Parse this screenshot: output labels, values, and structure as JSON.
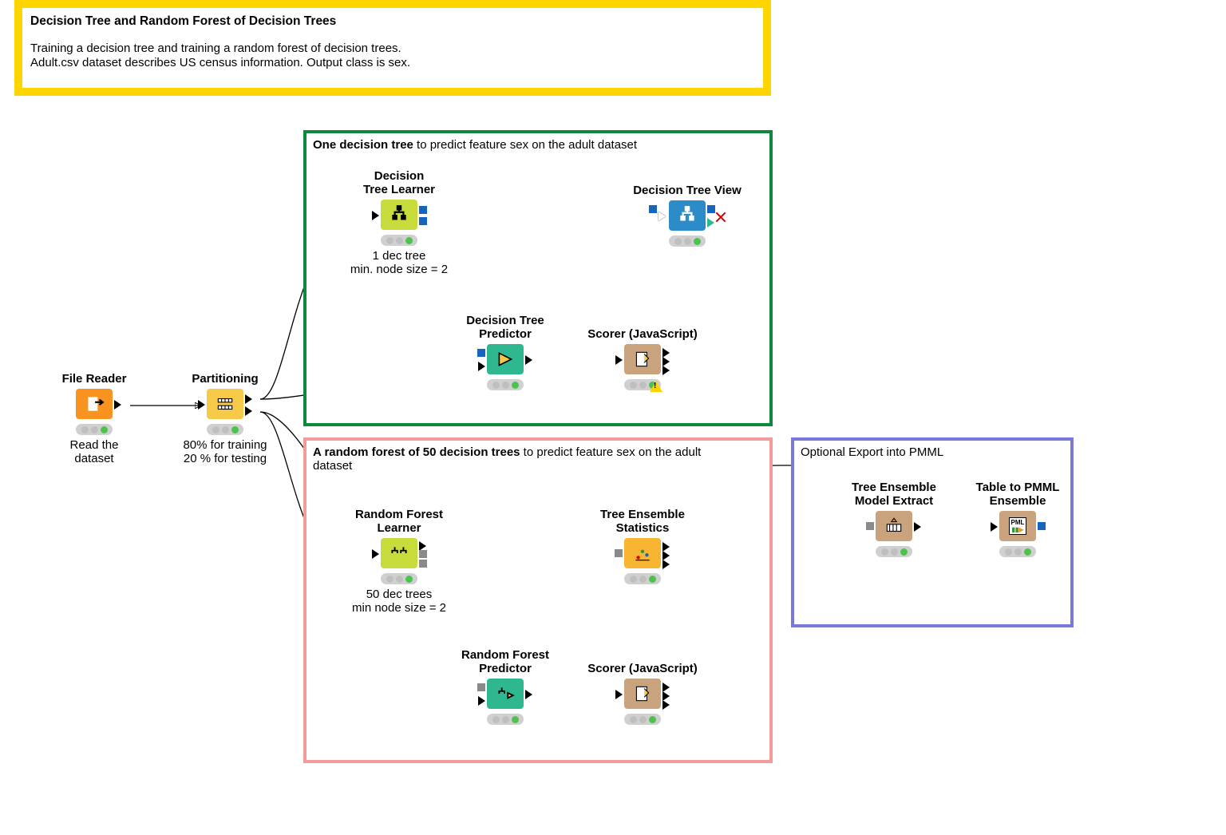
{
  "description": {
    "title": "Decision Tree and Random Forest of Decision Trees",
    "body": "Training a decision tree and training a random forest of decision trees.\nAdult.csv dataset describes US census information. Output class is sex."
  },
  "groups": {
    "green": {
      "title_prefix": "One decision tree",
      "title_rest": " to predict feature sex on the adult dataset"
    },
    "pink": {
      "title_prefix": "A random forest of 50 decision trees",
      "title_rest": " to predict feature sex on the adult dataset"
    },
    "purple": {
      "title": "Optional Export into PMML"
    }
  },
  "nodes": {
    "file_reader": {
      "label": "File Reader",
      "caption": "Read the\ndataset"
    },
    "partitioning": {
      "label": "Partitioning",
      "caption": "80% for training\n20 % for testing"
    },
    "dt_learner": {
      "label": "Decision\nTree Learner",
      "caption": "1 dec tree\nmin. node size = 2"
    },
    "dt_view": {
      "label": "Decision Tree View",
      "caption": ""
    },
    "dt_predictor": {
      "label": "Decision Tree\nPredictor",
      "caption": ""
    },
    "scorer1": {
      "label": "Scorer (JavaScript)",
      "caption": ""
    },
    "rf_learner": {
      "label": "Random Forest\nLearner",
      "caption": "50 dec trees\nmin node size = 2"
    },
    "te_stats": {
      "label": "Tree Ensemble\nStatistics",
      "caption": ""
    },
    "rf_predictor": {
      "label": "Random Forest\nPredictor",
      "caption": ""
    },
    "scorer2": {
      "label": "Scorer (JavaScript)",
      "caption": ""
    },
    "te_extract": {
      "label": "Tree Ensemble\nModel Extract",
      "caption": ""
    },
    "to_pmml": {
      "label": "Table to PMML\nEnsemble",
      "caption": ""
    }
  },
  "pmml_badge": "PML"
}
